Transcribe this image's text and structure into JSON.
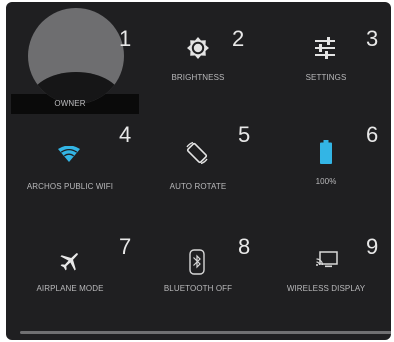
{
  "tiles": [
    {
      "number": "1",
      "label": "OWNER",
      "icon": "user-avatar"
    },
    {
      "number": "2",
      "label": "BRIGHTNESS",
      "icon": "brightness-icon"
    },
    {
      "number": "3",
      "label": "SETTINGS",
      "icon": "settings-sliders-icon"
    },
    {
      "number": "4",
      "label": "ARCHOS PUBLIC WIFI",
      "icon": "wifi-icon"
    },
    {
      "number": "5",
      "label": "AUTO ROTATE",
      "icon": "auto-rotate-icon"
    },
    {
      "number": "6",
      "label": "100%",
      "icon": "battery-icon"
    },
    {
      "number": "7",
      "label": "AIRPLANE MODE",
      "icon": "airplane-icon"
    },
    {
      "number": "8",
      "label": "BLUETOOTH OFF",
      "icon": "bluetooth-icon"
    },
    {
      "number": "9",
      "label": "WIRELESS DISPLAY",
      "icon": "wireless-display-icon"
    }
  ],
  "battery_level": 1.0,
  "colors": {
    "panel_background": "#1f1f21",
    "accent_blue": "#33b5e5",
    "text": "#b9b9bb"
  }
}
